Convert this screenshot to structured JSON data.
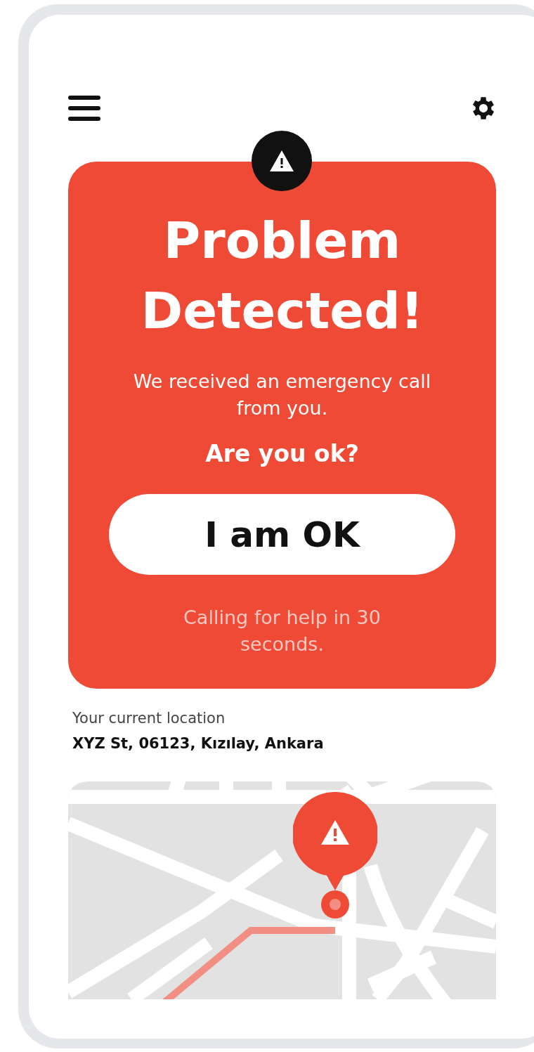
{
  "alert": {
    "title": "Problem Detected!",
    "message": "We received an emergency call from you.",
    "question": "Are you ok?",
    "button": "I am OK",
    "countdown": "Calling for help in 30 seconds."
  },
  "location": {
    "label": "Your current location",
    "address": "XYZ St, 06123, Kızılay, Ankara"
  }
}
